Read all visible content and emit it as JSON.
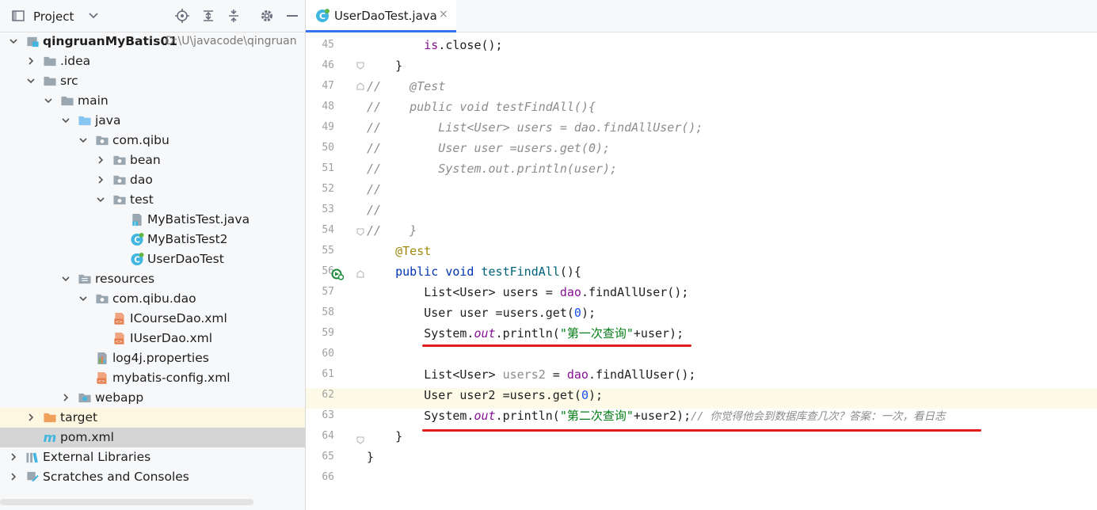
{
  "project_panel": {
    "title": "Project",
    "tree": [
      {
        "label": "qingruanMyBatis01",
        "path": "D:\\U\\javacode\\qingruan",
        "depth": 0,
        "expanded": true,
        "icon": "module-icon",
        "bold": true
      },
      {
        "label": ".idea",
        "depth": 1,
        "expanded": false,
        "icon": "folder-icon"
      },
      {
        "label": "src",
        "depth": 1,
        "expanded": true,
        "icon": "folder-icon"
      },
      {
        "label": "main",
        "depth": 2,
        "expanded": true,
        "icon": "folder-icon"
      },
      {
        "label": "java",
        "depth": 3,
        "expanded": true,
        "icon": "source-folder-icon"
      },
      {
        "label": "com.qibu",
        "depth": 4,
        "expanded": true,
        "icon": "package-icon"
      },
      {
        "label": "bean",
        "depth": 5,
        "expanded": false,
        "icon": "package-icon"
      },
      {
        "label": "dao",
        "depth": 5,
        "expanded": false,
        "icon": "package-icon"
      },
      {
        "label": "test",
        "depth": 5,
        "expanded": true,
        "icon": "package-icon"
      },
      {
        "label": "MyBatisTest.java",
        "depth": 6,
        "icon": "java-file-icon"
      },
      {
        "label": "MyBatisTest2",
        "depth": 6,
        "icon": "java-class-icon"
      },
      {
        "label": "UserDaoTest",
        "depth": 6,
        "icon": "java-class-icon"
      },
      {
        "label": "resources",
        "depth": 3,
        "expanded": true,
        "icon": "resources-folder-icon"
      },
      {
        "label": "com.qibu.dao",
        "depth": 4,
        "expanded": true,
        "icon": "package-icon"
      },
      {
        "label": "ICourseDao.xml",
        "depth": 5,
        "icon": "xml-file-icon"
      },
      {
        "label": "IUserDao.xml",
        "depth": 5,
        "icon": "xml-file-icon"
      },
      {
        "label": "log4j.properties",
        "depth": 4,
        "icon": "properties-file-icon"
      },
      {
        "label": "mybatis-config.xml",
        "depth": 4,
        "icon": "xml-file-icon"
      },
      {
        "label": "webapp",
        "depth": 3,
        "expanded": false,
        "icon": "web-folder-icon"
      },
      {
        "label": "target",
        "depth": 1,
        "expanded": false,
        "icon": "excluded-folder-icon",
        "highlight": "yellow"
      },
      {
        "label": "pom.xml",
        "depth": 1,
        "icon": "maven-icon",
        "highlight": "selected"
      },
      {
        "label": "External Libraries",
        "depth": 0,
        "expanded": false,
        "icon": "libraries-icon"
      },
      {
        "label": "Scratches and Consoles",
        "depth": 0,
        "expanded": false,
        "icon": "scratches-icon"
      }
    ]
  },
  "editor": {
    "tab": {
      "label": "UserDaoTest.java",
      "close": "×"
    },
    "line_numbers": [
      "45",
      "46",
      "47",
      "48",
      "49",
      "50",
      "51",
      "52",
      "53",
      "54",
      "55",
      "56",
      "57",
      "58",
      "59",
      "60",
      "61",
      "62",
      "63",
      "64",
      "65",
      "66"
    ],
    "lines": {
      "l45_a": "        ",
      "l45_b": "is",
      "l45_c": ".close();",
      "l46": "    }",
      "l47_a": "//",
      "l47_b": "    @Test",
      "l48": "//    public void testFindAll(){",
      "l49": "//        List<User> users = dao.findAllUser();",
      "l50": "//        User user =users.get(0);",
      "l51": "//        System.out.println(user);",
      "l52": "//",
      "l53": "//",
      "l54": "//    }",
      "l55": "    @Test",
      "l56_kw1": "    public ",
      "l56_kw2": "void ",
      "l56_fn": "testFindAll",
      "l56_end": "(){",
      "l57_a": "        List<User> users = ",
      "l57_b": "dao",
      "l57_c": ".findAllUser();",
      "l58_a": "        User user =users.get(",
      "l58_b": "0",
      "l58_c": ");",
      "l59_a": "        System.",
      "l59_b": "out",
      "l59_c": ".println(",
      "l59_d": "\"第一次查询\"",
      "l59_e": "+user);",
      "l61_a": "        List<User> ",
      "l61_b": "users2",
      "l61_c": " = ",
      "l61_d": "dao",
      "l61_e": ".findAllUser();",
      "l62_a": "        User user2 =users.get(",
      "l62_b": "0",
      "l62_c": ");",
      "l63_a": "        System.",
      "l63_b": "out",
      "l63_c": ".println(",
      "l63_d": "\"第二次查询\"",
      "l63_e": "+user2);",
      "l63_f": "// 你觉得他会到数据库查几次？答案：一次，看日志",
      "l64": "    }",
      "l65": "}"
    }
  },
  "colors": {
    "accent": "#3574f0",
    "underline": "#e31b1b",
    "keyword": "#0033b3",
    "string": "#067d17",
    "field": "#871094",
    "annotation": "#9e880d",
    "comment": "#8c8c8c"
  }
}
